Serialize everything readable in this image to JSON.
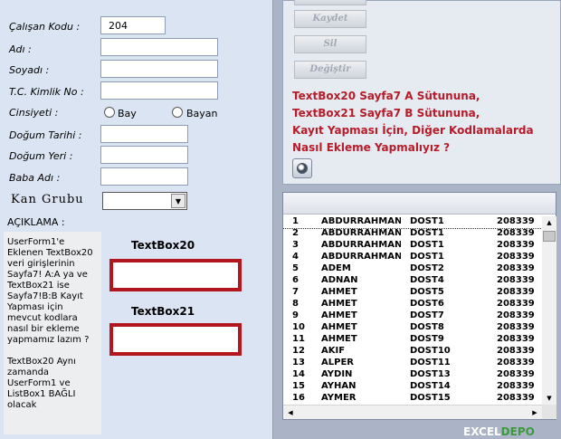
{
  "form": {
    "calisan_kodu": {
      "label": "Çalışan Kodu :",
      "value": "204"
    },
    "adi": {
      "label": "Adı :",
      "value": ""
    },
    "soyadi": {
      "label": "Soyadı :",
      "value": ""
    },
    "tc_kimlik": {
      "label": "T.C. Kimlik No :",
      "value": ""
    },
    "cinsiyeti": {
      "label": "Cinsiyeti :",
      "options": [
        "Bay",
        "Bayan"
      ]
    },
    "dogum_tarihi": {
      "label": "Doğum Tarihi :",
      "value": ""
    },
    "dogum_yeri": {
      "label": "Doğum Yeri :",
      "value": ""
    },
    "baba_adi": {
      "label": "Baba Adı :",
      "value": ""
    },
    "kan_grubu": {
      "label": "Kan Grubu",
      "value": ""
    },
    "aciklama_label": "AÇIKLAMA :",
    "note_paragraphs": [
      "UserForm1'e Eklenen TextBox20 veri girişlerinin Sayfa7! A:A ya ve TextBox21 ise Sayfa7!B:B Kayıt Yapması için mevcut kodlara nasıl bir ekleme yapmamız lazım ?",
      "TextBox20 Aynı zamanda UserForm1 ve ListBox1 BAĞLI olacak"
    ],
    "textbox20_label": "TextBox20",
    "textbox21_label": "TextBox21"
  },
  "buttons": {
    "kaydet": "Kaydet",
    "sil": "Sil",
    "degistir": "Değiştir"
  },
  "question_lines": [
    "TextBox20 Sayfa7 A Sütununa,",
    "TextBox21 Sayfa7 B Sütununa,",
    "Kayıt Yapması İçin, Diğer Kodlamalarda",
    "Nasıl Ekleme Yapmalıyız ?"
  ],
  "listbox": {
    "rows": [
      [
        "1",
        "ABDURRAHMAN",
        "DOST1",
        "208339"
      ],
      [
        "2",
        "ABDURRAHMAN",
        "DOST1",
        "208339"
      ],
      [
        "3",
        "ABDURRAHMAN",
        "DOST1",
        "208339"
      ],
      [
        "4",
        "ABDURRAHMAN",
        "DOST1",
        "208339"
      ],
      [
        "5",
        "ADEM",
        "DOST2",
        "208339"
      ],
      [
        "6",
        "ADNAN",
        "DOST4",
        "208339"
      ],
      [
        "7",
        "AHMET",
        "DOST5",
        "208339"
      ],
      [
        "8",
        "AHMET",
        "DOST6",
        "208339"
      ],
      [
        "9",
        "AHMET",
        "DOST7",
        "208339"
      ],
      [
        "10",
        "AHMET",
        "DOST8",
        "208339"
      ],
      [
        "11",
        "AHMET",
        "DOST9",
        "208339"
      ],
      [
        "12",
        "AKİF",
        "DOST10",
        "208339"
      ],
      [
        "13",
        "ALPER",
        "DOST11",
        "208339"
      ],
      [
        "14",
        "AYDIN",
        "DOST13",
        "208339"
      ],
      [
        "15",
        "AYHAN",
        "DOST14",
        "208339"
      ],
      [
        "16",
        "AYMER",
        "DOST15",
        "208339"
      ]
    ]
  },
  "logo": {
    "part1": "EXCEL",
    "part2": "DEPO"
  }
}
